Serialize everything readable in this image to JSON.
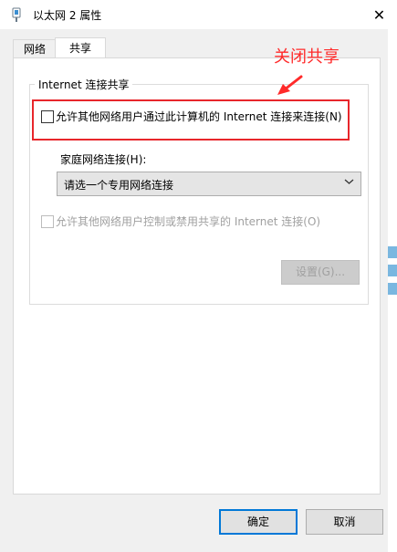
{
  "window": {
    "title": "以太网 2 属性",
    "close_glyph": "✕"
  },
  "tabs": [
    {
      "label": "网络"
    },
    {
      "label": "共享"
    }
  ],
  "group": {
    "title": "Internet 连接共享",
    "allow_share_label": "允许其他网络用户通过此计算机的 Internet 连接来连接(N)",
    "allow_share_checked": false,
    "home_network_label": "家庭网络连接(H):",
    "home_network_select": "请选一个专用网络连接",
    "allow_control_label": "允许其他网络用户控制或禁用共享的 Internet 连接(O)",
    "allow_control_checked": false,
    "settings_button": "设置(G)..."
  },
  "annotation": {
    "text": "关闭共享",
    "color": "#ff2a2a"
  },
  "footer": {
    "ok_button": "确定",
    "cancel_button": "取消"
  },
  "colors": {
    "accent": "#0078d7",
    "highlight_border": "#e8262b"
  }
}
